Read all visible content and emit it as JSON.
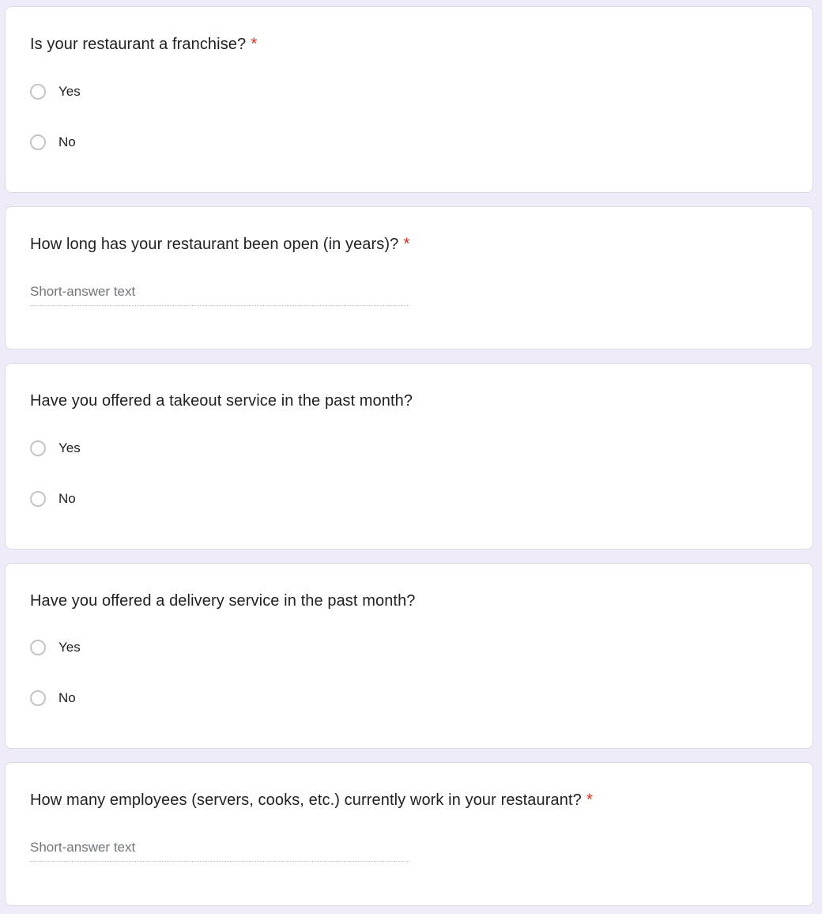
{
  "colors": {
    "background": "#f0ebf8",
    "card": "#ffffff",
    "required_asterisk": "#d93025"
  },
  "required_marker": "*",
  "questions": [
    {
      "title": "Is your restaurant a franchise?",
      "required": true,
      "type": "radio",
      "options": [
        "Yes",
        "No"
      ]
    },
    {
      "title": "How long has your restaurant been open (in years)?",
      "required": true,
      "type": "short-answer",
      "placeholder": "Short-answer text"
    },
    {
      "title": "Have you offered a takeout service in the past month?",
      "required": false,
      "type": "radio",
      "options": [
        "Yes",
        "No"
      ]
    },
    {
      "title": "Have you offered a delivery service in the past month?",
      "required": false,
      "type": "radio",
      "options": [
        "Yes",
        "No"
      ]
    },
    {
      "title": "How many employees (servers, cooks, etc.) currently work in your restaurant?",
      "required": true,
      "type": "short-answer",
      "placeholder": "Short-answer text"
    }
  ]
}
